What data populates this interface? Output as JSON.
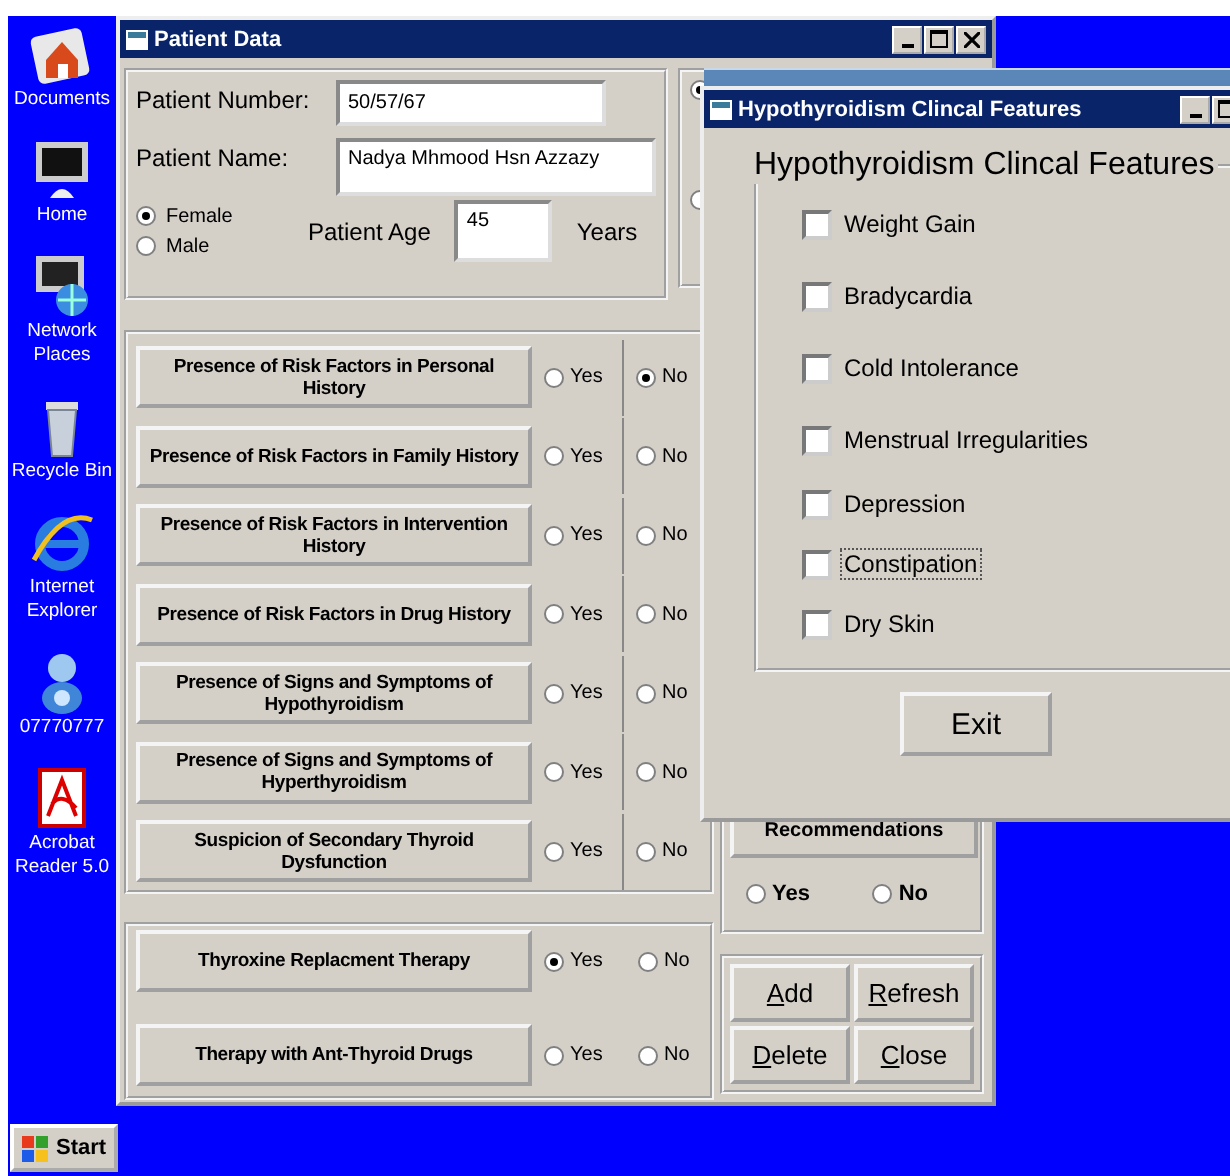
{
  "desktop_icons": [
    {
      "label": "Documents"
    },
    {
      "label": "Home"
    },
    {
      "label": "Network Places"
    },
    {
      "label": "Recycle Bin"
    },
    {
      "label": "Internet Explorer"
    },
    {
      "label": "07770777"
    },
    {
      "label": "Acrobat Reader 5.0"
    }
  ],
  "taskbar": {
    "start": "Start"
  },
  "patient_window": {
    "title": "Patient Data",
    "patient_number": {
      "label": "Patient Number:",
      "value": "50/57/67"
    },
    "patient_name": {
      "label": "Patient Name:",
      "value": "Nadya Mhmood Hsn Azzazy"
    },
    "sex": [
      {
        "label": "Female",
        "selected": true
      },
      {
        "label": "Male",
        "selected": false
      }
    ],
    "age": {
      "label": "Patient Age",
      "value": "45",
      "unit": "Years"
    },
    "covered_radios": [
      {
        "selected": true
      },
      {
        "selected": false
      }
    ],
    "questions": [
      {
        "label": "Presence of Risk Factors in Personal History",
        "options": [
          {
            "label": "Yes",
            "selected": false
          },
          {
            "label": "No",
            "selected": true
          }
        ]
      },
      {
        "label": "Presence of Risk Factors in Family History",
        "options": [
          {
            "label": "Yes",
            "selected": false
          },
          {
            "label": "No",
            "selected": false
          }
        ]
      },
      {
        "label": "Presence of Risk Factors in Intervention History",
        "options": [
          {
            "label": "Yes",
            "selected": false
          },
          {
            "label": "No",
            "selected": false
          }
        ]
      },
      {
        "label": "Presence of Risk Factors in Drug History",
        "options": [
          {
            "label": "Yes",
            "selected": false
          },
          {
            "label": "No",
            "selected": false
          }
        ]
      },
      {
        "label": "Presence of Signs and Symptoms of Hypothyroidism",
        "options": [
          {
            "label": "Yes",
            "selected": false
          },
          {
            "label": "No",
            "selected": false
          }
        ]
      },
      {
        "label": "Presence of Signs and Symptoms of Hyperthyroidism",
        "options": [
          {
            "label": "Yes",
            "selected": false
          },
          {
            "label": "No",
            "selected": false
          }
        ]
      },
      {
        "label": "Suspicion of Secondary Thyroid Dysfunction",
        "options": [
          {
            "label": "Yes",
            "selected": false
          },
          {
            "label": "No",
            "selected": false
          }
        ]
      }
    ],
    "therapies": [
      {
        "label": "Thyroxine Replacment Therapy",
        "options": [
          {
            "label": "Yes",
            "selected": true
          },
          {
            "label": "No",
            "selected": false
          }
        ]
      },
      {
        "label": "Therapy  with Ant-Thyroid Drugs",
        "options": [
          {
            "label": "Yes",
            "selected": false
          },
          {
            "label": "No",
            "selected": false
          }
        ]
      }
    ],
    "recommendations": {
      "label": "Recommendations",
      "options": [
        {
          "label": "Yes",
          "selected": false
        },
        {
          "label": "No",
          "selected": false
        }
      ]
    },
    "buttons": [
      {
        "accel": "A",
        "rest": "dd"
      },
      {
        "accel": "R",
        "rest": "efresh"
      },
      {
        "accel": "D",
        "rest": "elete"
      },
      {
        "accel": "C",
        "rest": "lose"
      }
    ]
  },
  "features_window": {
    "title": "Hypothyroidism Clincal Features",
    "heading": "Hypothyroidism Clincal Features",
    "features": [
      {
        "label": "Weight Gain",
        "checked": false,
        "focused": false
      },
      {
        "label": "Bradycardia",
        "checked": false,
        "focused": false
      },
      {
        "label": "Cold  Intolerance",
        "checked": false,
        "focused": false
      },
      {
        "label": "Menstrual Irregularities",
        "checked": false,
        "focused": false
      },
      {
        "label": "Depression",
        "checked": false,
        "focused": false
      },
      {
        "label": "Constipation",
        "checked": false,
        "focused": true
      },
      {
        "label": "Dry Skin",
        "checked": false,
        "focused": false
      }
    ],
    "exit": "Exit"
  }
}
